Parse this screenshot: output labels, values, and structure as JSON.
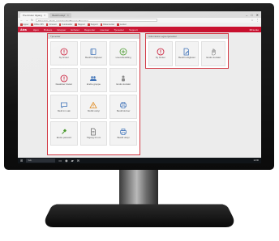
{
  "browser": {
    "tabs": [
      {
        "label": "Pre-bruker tilgang",
        "active": true
      },
      {
        "label": "Bestill utstyr",
        "active": false
      }
    ],
    "window_controls": [
      "–",
      "□",
      "✕"
    ],
    "url": "https://cp.ofsafe.no/AdminSelfService/Services",
    "bookmarks": [
      "Apper",
      "Office 365",
      "Intranett",
      "Kundesider",
      "Rapport",
      "Support",
      "Dokumenter",
      "Lenker"
    ]
  },
  "app": {
    "brand": "Atea",
    "nav": [
      "Hjem",
      "Brukere",
      "Grupper",
      "Enheter",
      "Rapporter",
      "Lisenser",
      "Tjenester",
      "Support"
    ],
    "user": "Mi konto"
  },
  "left_panel": {
    "title": "Tjenester",
    "tiles": [
      {
        "icon": "info-icon",
        "label": "Ny bruker"
      },
      {
        "icon": "book-icon",
        "label": "Bestill rettigheter"
      },
      {
        "icon": "plus-circle-icon",
        "label": "Lisensbestilling"
      },
      {
        "icon": "info-icon",
        "label": "Deaktiver bruker"
      },
      {
        "icon": "users-icon",
        "label": "Endre gruppe"
      },
      {
        "icon": "person-icon",
        "label": "Endre kontakt"
      },
      {
        "icon": "chat-icon",
        "label": "Meld inn sak"
      },
      {
        "icon": "warning-icon",
        "label": "Mobilt utstyr"
      },
      {
        "icon": "printer-icon",
        "label": "Bestill skriver"
      },
      {
        "icon": "plug-icon",
        "label": "Endre passord"
      },
      {
        "icon": "document-icon",
        "label": "Tilgang til rom"
      },
      {
        "icon": "printer-icon",
        "label": "Bestill utstyr"
      }
    ]
  },
  "right_panel": {
    "title": "Administrer egne tjenester",
    "tiles": [
      {
        "icon": "info-icon",
        "label": "Ny bruker"
      },
      {
        "icon": "document-edit-icon",
        "label": "Bestill rettigheter"
      },
      {
        "icon": "hand-icon",
        "label": "Endre kontakt"
      }
    ]
  },
  "taskbar": {
    "search_placeholder": "Søk",
    "time": "12:00"
  },
  "colors": {
    "brand_red": "#c8102e",
    "panel_border": "#d23a45",
    "icon_green": "#4a9a2e",
    "icon_blue": "#3a6fb6",
    "icon_orange": "#e08a1e"
  }
}
